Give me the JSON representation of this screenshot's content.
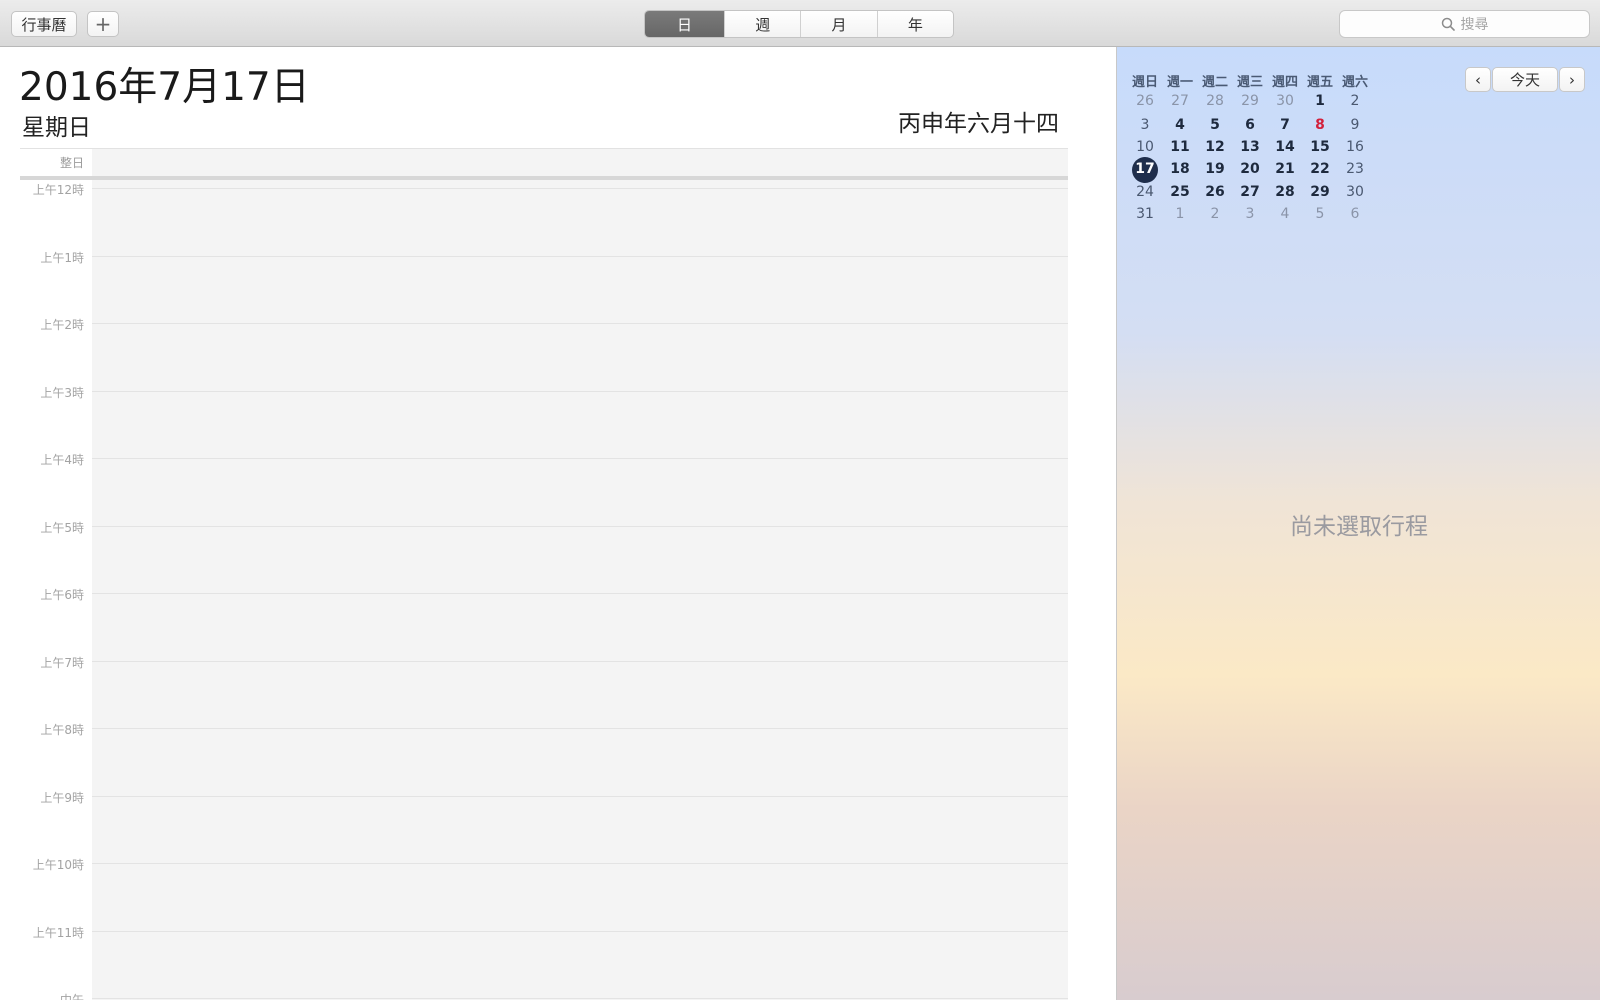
{
  "toolbar": {
    "calendars_label": "行事曆",
    "add_label": "+",
    "views": [
      {
        "label": "日",
        "active": true
      },
      {
        "label": "週",
        "active": false
      },
      {
        "label": "月",
        "active": false
      },
      {
        "label": "年",
        "active": false
      }
    ],
    "search_placeholder": "搜尋"
  },
  "day": {
    "date_title": "2016年7月17日",
    "weekday": "星期日",
    "lunar_date": "丙申年六月十四",
    "allday_label": "整日",
    "hours": [
      "上午12時",
      "上午1時",
      "上午2時",
      "上午3時",
      "上午4時",
      "上午5時",
      "上午6時",
      "上午7時",
      "上午8時",
      "上午9時",
      "上午10時",
      "上午11時",
      "中午"
    ]
  },
  "mini_calendar": {
    "weekday_headers": [
      "週日",
      "週一",
      "週二",
      "週三",
      "週四",
      "週五",
      "週六"
    ],
    "weeks": [
      [
        "26",
        "27",
        "28",
        "29",
        "30",
        "1",
        "2"
      ],
      [
        "3",
        "4",
        "5",
        "6",
        "7",
        "8",
        "9"
      ],
      [
        "10",
        "11",
        "12",
        "13",
        "14",
        "15",
        "16"
      ],
      [
        "17",
        "18",
        "19",
        "20",
        "21",
        "22",
        "23"
      ],
      [
        "24",
        "25",
        "26",
        "27",
        "28",
        "29",
        "30"
      ],
      [
        "31",
        "1",
        "2",
        "3",
        "4",
        "5",
        "6"
      ]
    ],
    "today": "17",
    "holiday": "8",
    "prev_label": "‹",
    "today_label": "今天",
    "next_label": "›"
  },
  "inspector": {
    "no_event_text": "尚未選取行程"
  },
  "colors": {
    "today_circle": "#1f2e4c",
    "holiday": "#d2213c",
    "active_segment": "#6e6e6e"
  }
}
